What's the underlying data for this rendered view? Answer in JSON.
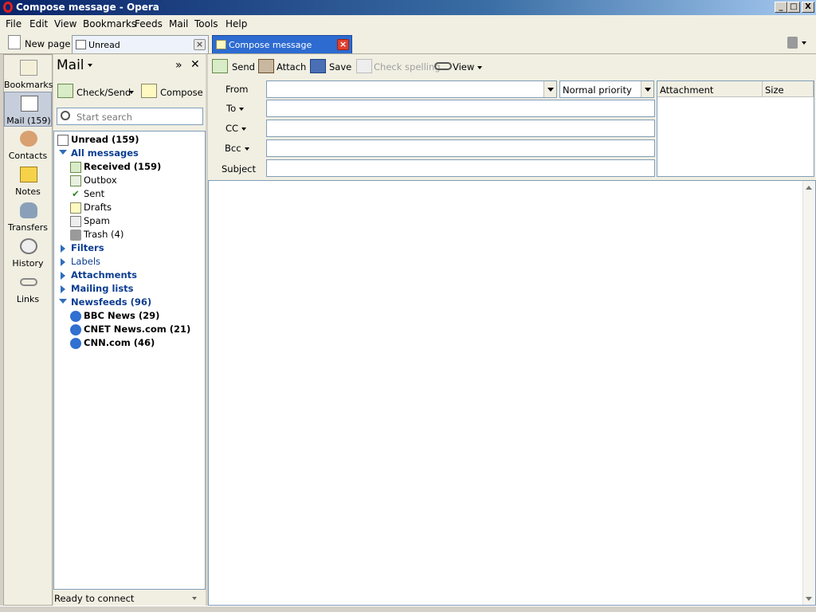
{
  "window": {
    "title": "Compose message - Opera",
    "min": "_",
    "max": "□",
    "close": "X"
  },
  "menu": [
    "File",
    "Edit",
    "View",
    "Bookmarks",
    "Feeds",
    "Mail",
    "Tools",
    "Help"
  ],
  "tabs": {
    "new_page": "New page",
    "unread": "Unread",
    "compose": "Compose message"
  },
  "sidebar": [
    "Bookmarks",
    "Mail (159)",
    "Contacts",
    "Notes",
    "Transfers",
    "History",
    "Links"
  ],
  "panel": {
    "title": "Mail",
    "check_send": "Check/Send",
    "compose": "Compose",
    "search_placeholder": "Start search",
    "tree": {
      "unread": "Unread (159)",
      "all_messages": "All messages",
      "received": "Received (159)",
      "outbox": "Outbox",
      "sent": "Sent",
      "drafts": "Drafts",
      "spam": "Spam",
      "trash": "Trash (4)",
      "filters": "Filters",
      "labels": "Labels",
      "attachments": "Attachments",
      "mailing_lists": "Mailing lists",
      "newsfeeds": "Newsfeeds (96)",
      "bbc": "BBC News (29)",
      "cnet": "CNET News.com (21)",
      "cnn": "CNN.com (46)"
    },
    "status": "Ready to connect"
  },
  "toolbar": {
    "send": "Send",
    "attach": "Attach",
    "save": "Save",
    "check_spelling": "Check spelling",
    "view": "View"
  },
  "compose": {
    "from_label": "From",
    "to_label": "To",
    "cc_label": "CC",
    "bcc_label": "Bcc",
    "subject_label": "Subject",
    "priority": "Normal priority",
    "attach_col": "Attachment",
    "size_col": "Size"
  }
}
